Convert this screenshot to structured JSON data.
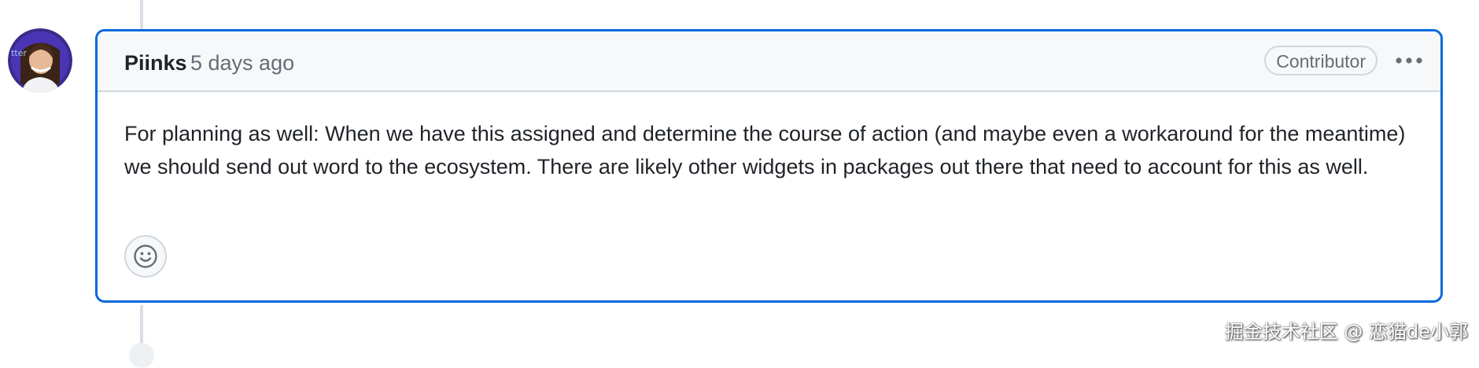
{
  "comment": {
    "author": "Piinks",
    "timestamp": "5 days ago",
    "role_badge": "Contributor",
    "body": "For planning as well: When we have this assigned and determine the course of action (and maybe even a workaround for the meantime) we should send out word to the ecosystem. There are likely other widgets in packages out there that need to account for this as well.",
    "avatar_icon": "user-avatar",
    "more_icon": "kebab-horizontal-icon",
    "reaction_icon": "smiley-icon"
  },
  "watermark": "掘金技术社区 @ 恋猫de小郭",
  "colors": {
    "accent_border": "#0969da",
    "header_bg": "#f6f8fa",
    "muted_text": "#656d76",
    "border": "#d0d7de"
  }
}
